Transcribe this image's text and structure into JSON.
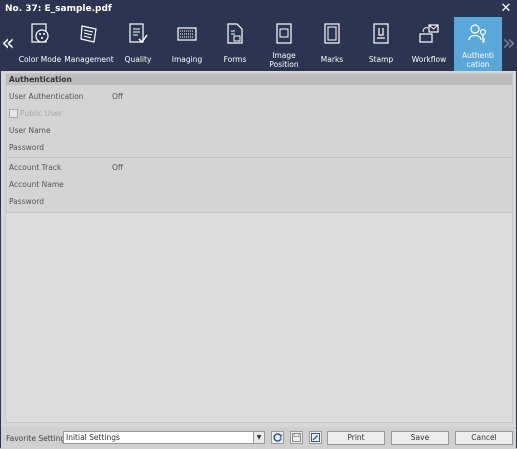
{
  "window": {
    "title": "No. 37: E_sample.pdf"
  },
  "toolbar": {
    "tabs": [
      {
        "label": "Color Mode",
        "icon": "color-mode-icon"
      },
      {
        "label": "Management",
        "icon": "management-icon"
      },
      {
        "label": "Quality",
        "icon": "quality-icon"
      },
      {
        "label": "Imaging",
        "icon": "imaging-icon"
      },
      {
        "label": "Forms",
        "icon": "forms-icon"
      },
      {
        "label": "Image Position",
        "icon": "image-position-icon"
      },
      {
        "label": "Marks",
        "icon": "marks-icon"
      },
      {
        "label": "Stamp",
        "icon": "stamp-icon"
      },
      {
        "label": "Workflow",
        "icon": "workflow-icon"
      },
      {
        "label": "Authentication",
        "label_lines": [
          "Authenti",
          "cation"
        ],
        "icon": "authentication-icon",
        "active": true
      }
    ]
  },
  "authentication": {
    "header": "Authentication",
    "user_authentication": {
      "label": "User Authentication",
      "value": "Off"
    },
    "public_user": {
      "label": "Public User",
      "checked": false
    },
    "user_name": {
      "label": "User Name"
    },
    "password": {
      "label": "Password"
    },
    "account_track": {
      "label": "Account Track",
      "value": "Off"
    },
    "account_name": {
      "label": "Account Name"
    },
    "account_password": {
      "label": "Password"
    }
  },
  "bottom": {
    "favorite_label": "Favorite Setting",
    "favorite_value": "Initial Settings",
    "print_label": "Print",
    "save_label": "Save",
    "cancel_label": "Cancel"
  },
  "colors": {
    "titlebar": "#2b3552",
    "active_tab": "#5aa7da"
  }
}
